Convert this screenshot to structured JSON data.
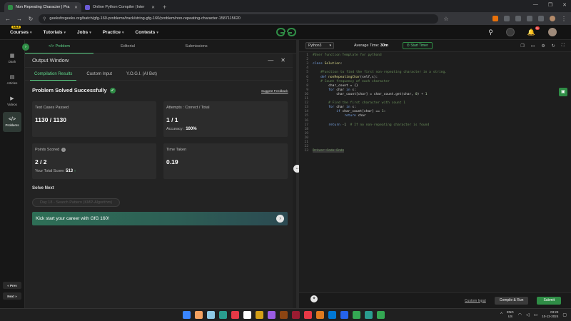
{
  "browser": {
    "tabs": [
      {
        "title": "Non Repeating Character | Pra",
        "fav": "#2f8d46",
        "active": true
      },
      {
        "title": "Online Python Compiler (Inter",
        "fav": "#6b5bd6",
        "active": false
      }
    ],
    "url": "geeksforgeeks.org/batch/gfg-160-problems/track/string-gfg-160/problem/non-repeating-character-1587115620"
  },
  "gfg_nav": {
    "sale_badge": "SALE",
    "menus": [
      "Courses",
      "Tutorials",
      "Jobs",
      "Practice",
      "Contests"
    ],
    "logo": "GG",
    "notif_count": "21"
  },
  "sidebar": {
    "items": [
      {
        "label": "Dash",
        "icon": "▦"
      },
      {
        "label": "Articles",
        "icon": "▤"
      },
      {
        "label": "Videos",
        "icon": "▶"
      },
      {
        "label": "Problems",
        "icon": "</>"
      }
    ],
    "prev": "« Prev",
    "next": "Next »"
  },
  "problem_tabs": {
    "problem": "</> Problem",
    "editorial": "Editorial",
    "submissions": "Submissions"
  },
  "output": {
    "title": "Output Window",
    "tabs": [
      "Compilation Results",
      "Custom Input",
      "Y.O.G.I. (AI Bot)"
    ],
    "status": "Problem Solved Successfully",
    "feedback": "Suggest Feedback",
    "cards": {
      "test_cases_label": "Test Cases Passed",
      "test_cases_value": "1130 / 1130",
      "attempts_label": "Attempts : Correct / Total",
      "attempts_value": "1 / 1",
      "accuracy_label": "Accuracy :",
      "accuracy_value": "100%",
      "points_label": "Points Scored",
      "points_value": "2 / 2",
      "total_score_label": "Your Total Score:",
      "total_score_value": "513",
      "time_label": "Time Taken",
      "time_value": "0.19"
    },
    "solve_next": "Solve Next",
    "next_problem": "Day 18 - Search Pattern (KMP-Algorithm)",
    "banner": "Kick start your career with GfG 160!"
  },
  "editor": {
    "language": "Python3",
    "avg_time_label": "Average Time:",
    "avg_time_value": "30m",
    "timer": "Start Timer",
    "compile": "Compile & Run",
    "custom_input": "Custom Input",
    "submit": "Submit",
    "lines": [
      [
        {
          "c": "cm",
          "t": "#User function Template for python3"
        }
      ],
      [],
      [
        {
          "c": "kw",
          "t": "class "
        },
        {
          "c": "fn",
          "t": "Solution"
        },
        {
          "c": "",
          "t": ":"
        }
      ],
      [],
      [
        {
          "c": "cm",
          "t": "    #Function to find the first non-repeating character in a string."
        }
      ],
      [
        {
          "c": "kw",
          "t": "    def "
        },
        {
          "c": "fn",
          "t": "nonRepeatingChar"
        },
        {
          "c": "",
          "t": "(self,s):"
        }
      ],
      [
        {
          "c": "cm",
          "t": "    # Count frequency of each character"
        }
      ],
      [
        {
          "c": "",
          "t": "        char_count = {}"
        }
      ],
      [
        {
          "c": "kw",
          "t": "        for "
        },
        {
          "c": "",
          "t": "char "
        },
        {
          "c": "kw",
          "t": "in "
        },
        {
          "c": "",
          "t": "s:"
        }
      ],
      [
        {
          "c": "",
          "t": "            char_count[char] = char_count.get(char, "
        },
        {
          "c": "num",
          "t": "0"
        },
        {
          "c": "",
          "t": ") + "
        },
        {
          "c": "num",
          "t": "1"
        }
      ],
      [],
      [
        {
          "c": "cm",
          "t": "        # Find the first character with count 1"
        }
      ],
      [
        {
          "c": "kw",
          "t": "        for "
        },
        {
          "c": "",
          "t": "char "
        },
        {
          "c": "kw",
          "t": "in "
        },
        {
          "c": "",
          "t": "s:"
        }
      ],
      [
        {
          "c": "kw",
          "t": "            if "
        },
        {
          "c": "",
          "t": "char_count[char] == "
        },
        {
          "c": "num",
          "t": "1"
        },
        {
          "c": "",
          "t": ":"
        }
      ],
      [
        {
          "c": "kw",
          "t": "                return "
        },
        {
          "c": "",
          "t": "char"
        }
      ],
      [],
      [
        {
          "c": "kw",
          "t": "        return "
        },
        {
          "c": "num",
          "t": "-1"
        },
        {
          "c": "cm",
          "t": "  # If no non-repeating character is found"
        }
      ],
      [],
      [],
      [],
      [],
      [],
      [
        {
          "c": "hl",
          "t": "Driver Code Ends"
        }
      ]
    ]
  },
  "taskbar": {
    "icons": [
      "#3a86ff",
      "#f4a261",
      "#8ecae6",
      "#2a9d8f",
      "#e63946",
      "#ffffff",
      "#d4a017",
      "#9b5de5",
      "#8b4513",
      "#9b1c31",
      "#e63946",
      "#e07a1f",
      "#0078d4",
      "#2563eb",
      "#34a853",
      "#2a9d8f",
      "#34a853"
    ],
    "lang_top": "ENG",
    "lang_bottom": "US",
    "time": "03:23",
    "date": "10-12-2024"
  }
}
